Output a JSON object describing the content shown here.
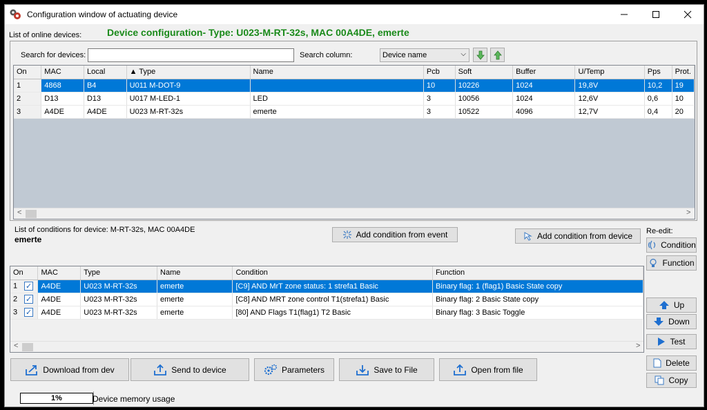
{
  "window": {
    "title": "Configuration window of actuating device"
  },
  "header": {
    "online_devices_label": "List of online devices:",
    "config_heading": "Device configuration- Type: U023-M-RT-32s, MAC 00A4DE, emerte"
  },
  "search": {
    "label": "Search for devices:",
    "value": "",
    "column_label": "Search column:",
    "column_value": "Device name"
  },
  "devices": {
    "columns": [
      "On",
      "MAC",
      "Local",
      "▲ Type",
      "Name",
      "Pcb",
      "Soft",
      "Buffer",
      "U/Temp",
      "Pps",
      "Prot."
    ],
    "rows": [
      [
        "1",
        "4868",
        "B4",
        "U011 M-DOT-9",
        "",
        "10",
        "10226",
        "1024",
        "19,8V",
        "10,2",
        "19"
      ],
      [
        "2",
        "D13",
        "D13",
        "U017 M-LED-1",
        "LED",
        "3",
        "10056",
        "1024",
        "12,6V",
        "0,6",
        "10"
      ],
      [
        "3",
        "A4DE",
        "A4DE",
        "U023 M-RT-32s",
        "emerte",
        "3",
        "10522",
        "4096",
        "12,7V",
        "0,4",
        "20"
      ]
    ]
  },
  "conditions_header": {
    "label": "List of conditions for device: M-RT-32s, MAC 00A4DE",
    "device_name": "emerte",
    "add_from_event": "Add condition from event",
    "add_from_device": "Add condition from device"
  },
  "conditions": {
    "columns": [
      "On",
      "MAC",
      "Type",
      "Name",
      "Condition",
      "Function"
    ],
    "rows": [
      [
        "1",
        "A4DE",
        "U023 M-RT-32s",
        "emerte",
        "[C9] AND  MrT zone status: 1 strefa1 Basic",
        "Binary flag:  1 (flag1)  Basic State copy"
      ],
      [
        "2",
        "A4DE",
        "U023 M-RT-32s",
        "emerte",
        "[C8] AND  MRT zone control T1(strefa1)  Basic",
        "Binary flag:  2  Basic State copy"
      ],
      [
        "3",
        "A4DE",
        "U023 M-RT-32s",
        "emerte",
        "[80] AND  Flags T1(flag1) T2  Basic",
        "Binary flag:  3  Basic Toggle"
      ]
    ]
  },
  "side": {
    "reedit_label": "Re-edit:",
    "condition": "Condition",
    "function": "Function",
    "up": "Up",
    "down": "Down",
    "test": "Test",
    "delete": "Delete",
    "copy": "Copy"
  },
  "bottom": {
    "download": "Download from dev",
    "send": "Send to device",
    "parameters": "Parameters",
    "save": "Save to File",
    "open": "Open from file"
  },
  "status": {
    "memory_percent": "1%",
    "memory_label": "Device memory usage"
  },
  "icons": {
    "app": "gear-app-icon",
    "minimize": "minimize-icon",
    "maximize": "maximize-icon",
    "close": "close-icon"
  },
  "colors": {
    "heading": "#1a8a1a",
    "selection": "#0078d7",
    "grid_bg": "#c0c9d3"
  }
}
